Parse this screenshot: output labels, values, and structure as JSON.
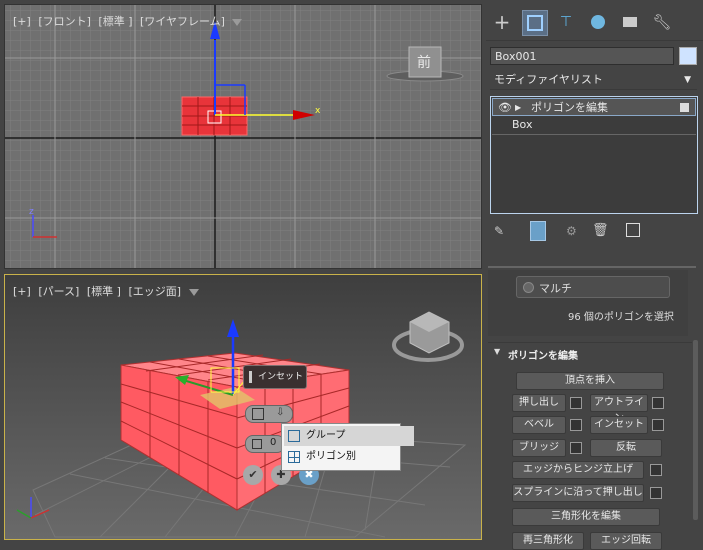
{
  "top_viewport": {
    "label_parts": [
      "[+]",
      "[フロント]",
      "[標準 ]",
      "[ワイヤフレーム]"
    ],
    "axis_x": "x",
    "axis_z": "z",
    "viewcube_label": "前"
  },
  "bottom_viewport": {
    "label_parts": [
      "[+]",
      "[パース]",
      "[標準 ]",
      "[エッジ面]"
    ],
    "caddy_title": "インセット",
    "caddy_value": "0",
    "flyout": {
      "items": [
        {
          "label": "グループ"
        },
        {
          "label": "ポリゴン別"
        }
      ]
    }
  },
  "command_panel": {
    "object_name": "Box001",
    "object_color": "#cfe3ff",
    "modifier_list_label": "モディファイヤリスト",
    "stack": {
      "item1": "ポリゴンを編集",
      "item2": "Box"
    },
    "selection": {
      "multi_label": "マルチ",
      "status": "96 個のポリゴンを選択"
    },
    "rollout": {
      "title": "ポリゴンを編集",
      "insert_vertex": "頂点を挿入",
      "extrude": "押し出し",
      "outline": "アウトライン",
      "bevel": "ベベル",
      "inset": "インセット",
      "bridge": "ブリッジ",
      "flip": "反転",
      "hinge": "エッジからヒンジ立上げ",
      "extrude_spline": "スプラインに沿って押し出し",
      "edit_tri": "三角形化を編集",
      "retri": "再三角形化",
      "turn": "エッジ回転"
    }
  },
  "colors": {
    "box_red": "#e8343a",
    "box_pink": "#ff7a80",
    "selection_gold": "#e2c46a"
  }
}
